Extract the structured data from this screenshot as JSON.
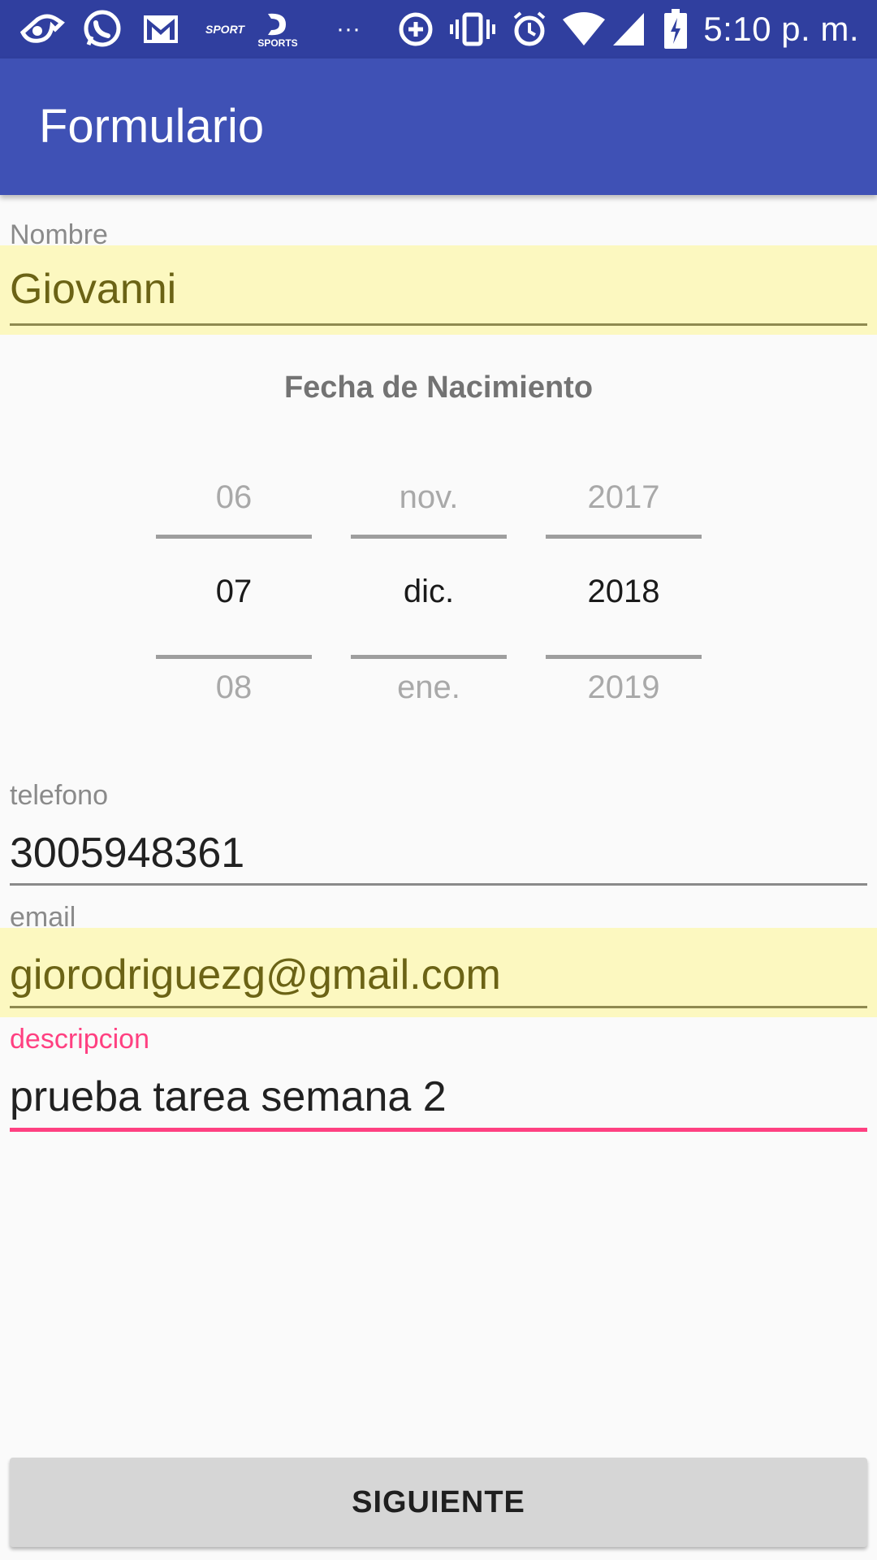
{
  "status_bar": {
    "time": "5:10 p. m.",
    "overflow": "···",
    "icons": [
      "whistle-icon",
      "whatsapp-icon",
      "gmail-icon",
      "sport-app-icon",
      "d-sports-icon",
      "overflow-dots-icon",
      "data-saver-icon",
      "vibrate-icon",
      "alarm-icon",
      "wifi-icon",
      "signal-icon",
      "battery-charging-icon"
    ],
    "sport_icon_text": "SPORT",
    "d_sports_text": "SPORTS"
  },
  "appbar": {
    "title": "Formulario"
  },
  "form": {
    "nombre": {
      "label": "Nombre",
      "value": "Giovanni"
    },
    "fecha": {
      "title": "Fecha de Nacimiento",
      "day": {
        "prev": "06",
        "selected": "07",
        "next": "08"
      },
      "month": {
        "prev": "nov.",
        "selected": "dic.",
        "next": "ene."
      },
      "year": {
        "prev": "2017",
        "selected": "2018",
        "next": "2019"
      }
    },
    "telefono": {
      "label": "telefono",
      "value": "3005948361"
    },
    "email": {
      "label": "email",
      "value": "giorodriguezg@gmail.com"
    },
    "descripcion": {
      "label": "descripcion",
      "value": "prueba tarea semana 2"
    }
  },
  "button": {
    "label": "SIGUIENTE"
  },
  "colors": {
    "status_bar": "#303f9f",
    "appbar": "#3f51b5",
    "accent": "#ff4081",
    "autofill": "#fcf8c0"
  }
}
